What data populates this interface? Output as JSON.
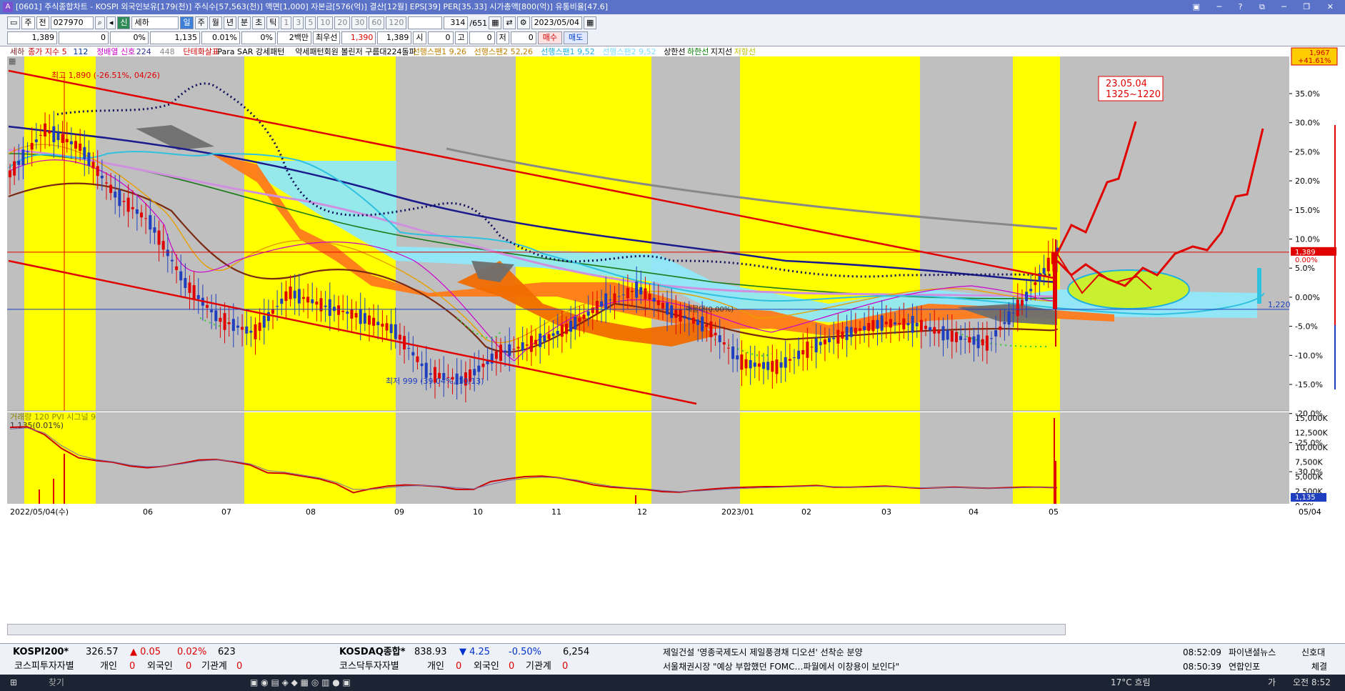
{
  "window": {
    "title": "[0601] 주식종합차트 - KOSPI 외국인보유[179(천)] 주식수[57,563(천)] 액면[1,000] 자본금[576(억)] 결산[12월] EPS[39] PER[35.33] 시가총액[800(억)] 유통비율[47.6]",
    "icon_label": "A"
  },
  "toolbar": {
    "mode_main": "주",
    "prev_label": "전",
    "code": "027970",
    "fav_tag": "신",
    "stock_name": "세하",
    "periods": [
      "일",
      "주",
      "월",
      "년",
      "분",
      "초",
      "틱"
    ],
    "intervals": [
      "1",
      "3",
      "5",
      "10",
      "20",
      "30",
      "60",
      "120"
    ],
    "count": "314",
    "count_total": "/651",
    "date": "2023/05/04",
    "quote_price": "1,389",
    "quote_change": "0",
    "quote_pct": "0%",
    "quote_price2": "1,135",
    "quote_pct2": "0.01%",
    "quote_pct3": "0%",
    "unit": "2백만",
    "pref_label": "최우선",
    "ask": "1,390",
    "bid": "1,389",
    "open_label": "시",
    "open_val": "0",
    "high_label": "고",
    "high_val": "0",
    "low_label": "저",
    "low_val": "0",
    "buy_button": "매수",
    "sell_button": "매도"
  },
  "legend": {
    "items": [
      {
        "text": "세하",
        "color": "#7a1f1f"
      },
      {
        "text": "종가 지수 5",
        "color": "#cc0000"
      },
      {
        "text": "112",
        "color": "#003399"
      },
      {
        "text": "정배열 신호",
        "color": "#cc00cc"
      },
      {
        "text": "224",
        "color": "#333399"
      },
      {
        "text": "448",
        "color": "#888888"
      },
      {
        "text": "단테화살표",
        "color": "#cc0000"
      },
      {
        "text": "Para SAR 강세패턴",
        "color": "#000000"
      },
      {
        "text": "약세패턴",
        "color": "#000000"
      },
      {
        "text": "회원 볼린저 구름대224돌파",
        "color": "#000000"
      },
      {
        "text": "선행스팬1 9,26",
        "color": "#c08000"
      },
      {
        "text": "선행스팬2 52,26",
        "color": "#c08000"
      },
      {
        "text": "선행스팬1 9,52",
        "color": "#20b0e0"
      },
      {
        "text": "선행스팬2 9,52",
        "color": "#80e0ff"
      },
      {
        "text": "상한선",
        "color": "#000000"
      },
      {
        "text": "하한선",
        "color": "#008000"
      },
      {
        "text": "지지선",
        "color": "#000000"
      },
      {
        "text": "저항선",
        "color": "#c0c000"
      }
    ]
  },
  "annotations": {
    "high": "최고 1,890 (-26.51%, 04/26)",
    "low": "최저 999 (39.04%, 10/13)",
    "box_date": "23.05.04",
    "box_range": "1325~1220",
    "midline": "매물대(0.00%)",
    "corner_price": "1,967",
    "corner_pct": "+41.61%",
    "current_tag": "1,389",
    "current_pct": "0.00%",
    "support_tag": "1,220"
  },
  "chart_data": [
    {
      "type": "line",
      "title": "세하 일봉",
      "y_axis_labels": [
        "35.0%",
        "30.0%",
        "25.0%",
        "20.0%",
        "15.0%",
        "10.0%",
        "5.0%",
        "0.00%",
        "-5.0%",
        "-10.0%",
        "-15.0%",
        "-20.0%",
        "-25.0%",
        "-30.0%"
      ],
      "x_labels": [
        "2022/05/04(수)",
        "06",
        "07",
        "08",
        "09",
        "10",
        "11",
        "12",
        "2023/01",
        "02",
        "03",
        "04",
        "05",
        "05/04"
      ],
      "series": [
        {
          "name": "세하",
          "color": "#7a1f1f",
          "values": [
            1620,
            1750,
            1700,
            1560,
            1480,
            1300,
            1190,
            1150,
            1270,
            1230,
            1200,
            1160,
            1030,
            1010,
            1090,
            1120,
            1165,
            1240,
            1280,
            1210,
            1170,
            1060,
            1050,
            1110,
            1150,
            1180,
            1175,
            1140,
            1120,
            1240,
            1390
          ]
        },
        {
          "name": "224",
          "color": "#333399",
          "values": [
            1580,
            1560,
            1540,
            1520,
            1500,
            1475,
            1450,
            1430,
            1410,
            1395,
            1380,
            1365,
            1350,
            1335,
            1320,
            1310,
            1300,
            1290,
            1282,
            1275,
            1270,
            1265,
            1262,
            1258,
            1255,
            1252,
            1250,
            1249,
            1248,
            1247,
            1246
          ]
        }
      ],
      "y_range_price": [
        920,
        1967
      ],
      "current_price": 1389,
      "support_price": 1220,
      "high": {
        "price": 1890,
        "date": "04/26"
      },
      "low": {
        "price": 999,
        "date": "10/13"
      }
    },
    {
      "type": "line",
      "title": "거래량 120 PVI 시그널 9",
      "series": [
        {
          "name": "PVI",
          "color": "#cc0000",
          "values": [
            13800,
            13900,
            12500,
            10000,
            8300,
            7800,
            7500,
            6800,
            6500,
            6800,
            7300,
            7900,
            8000,
            7600,
            7000,
            5600,
            5500,
            5000,
            4500,
            3600,
            2000,
            2700,
            3200,
            3400,
            3300,
            3100,
            2600,
            2600,
            4000,
            4500,
            4900,
            5000,
            4700,
            4100,
            3400,
            3000,
            2800,
            2600,
            2200,
            2100,
            2400,
            2700,
            2900,
            3000,
            3100,
            3100,
            3200,
            3300,
            3000,
            3000,
            3100,
            3200,
            3000,
            2800,
            2900,
            3000,
            2900,
            2800,
            2900,
            3000,
            3000,
            2900
          ]
        },
        {
          "name": "시그널 9",
          "color": "#7a6aa0",
          "values": [
            13500,
            13700,
            12800,
            10500,
            8800,
            8000,
            7600,
            7000,
            6700,
            6800,
            7200,
            7700,
            7900,
            7700,
            7200,
            6000,
            5700,
            5200,
            4700,
            3900,
            2600,
            2600,
            2900,
            3200,
            3300,
            3200,
            2900,
            2700,
            3500,
            4200,
            4600,
            4800,
            4700,
            4300,
            3700,
            3200,
            2900,
            2700,
            2400,
            2200,
            2300,
            2500,
            2700,
            2800,
            2900,
            3000,
            3100,
            3200,
            3100,
            3000,
            3000,
            3100,
            3000,
            2900,
            2900,
            2900,
            2900,
            2800,
            2800,
            2900,
            3000,
            2900
          ]
        }
      ],
      "y_axis_labels": [
        "15,000K",
        "12,500K",
        "10,000K",
        "7,500K",
        "5,000K",
        "2,500K",
        "0.0%"
      ],
      "y_range": [
        0,
        16000
      ],
      "value_label": "1,135",
      "legend_value": "1,135(0.01%)"
    }
  ],
  "ticker": {
    "row1": [
      {
        "name": "KOSPI200*",
        "value": "326.57",
        "change": "▲ 0.05",
        "pct": "0.02%",
        "vol": "623"
      },
      {
        "name": "KOSDAQ종합*",
        "value": "838.93",
        "change": "▼ 4.25",
        "pct": "-0.50%",
        "vol": "6,254"
      }
    ],
    "news1": "제일건설 '영종국제도시 제일풍경채 디오션' 선착순 분양",
    "news1_time": "08:52:09",
    "news1_src": "파이낸셜뉴스",
    "news1_extra": "신호대",
    "row2_left": "코스피투자자별",
    "row2_right": "코스닥투자자별",
    "inv_personal": "개인",
    "inv_foreign": "외국인",
    "inv_inst": "기관계",
    "inv_value": "0",
    "news2": "서울채권시장 \"예상 부합했던 FOMC…파월에서 이창용이 보인다\"",
    "news2_time": "08:50:39",
    "news2_src": "연합인포",
    "news2_extra": "체결"
  },
  "taskbar": {
    "search": "찾기",
    "temp": "17°C 흐림",
    "clock": "오전 8:52",
    "lang": "가"
  }
}
